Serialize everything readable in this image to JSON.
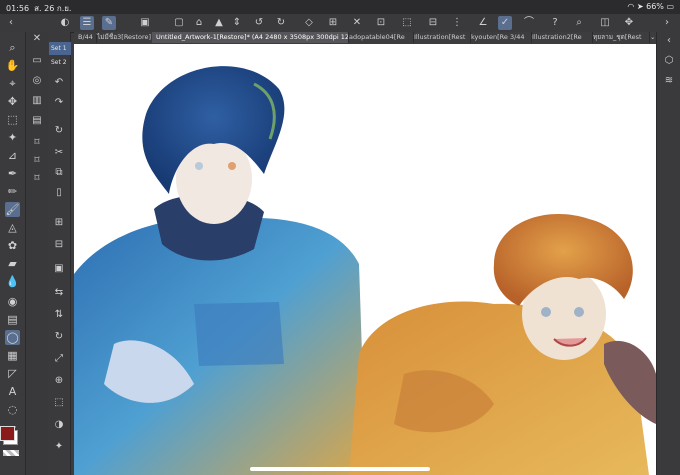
{
  "status": {
    "time": "01:56",
    "date": "ส. 26 ก.ย.",
    "battery": "66%"
  },
  "tabs": [
    {
      "label": "B/44",
      "active": false
    },
    {
      "label": "ไม่มีชื่อ3[Restore]",
      "active": false
    },
    {
      "label": "Untitled_Artwork-1[Restore]* (A4 2480 x 3508px 300dpi 125.7%)",
      "active": true
    },
    {
      "label": "adopatable04[Re",
      "active": false
    },
    {
      "label": "Illustration[Rest",
      "active": false
    },
    {
      "label": "kyouten[Re 3/44",
      "active": false
    },
    {
      "label": "Illustration2[Re",
      "active": false
    },
    {
      "label": "ทุยลาม_ชุด[Rest",
      "active": false
    }
  ],
  "sets": {
    "set1": "Set 1",
    "set2": "Set 2"
  },
  "colors": {
    "main": "#8b1a1a",
    "sub": "#ffffff",
    "accent": "#5a6f8f"
  }
}
